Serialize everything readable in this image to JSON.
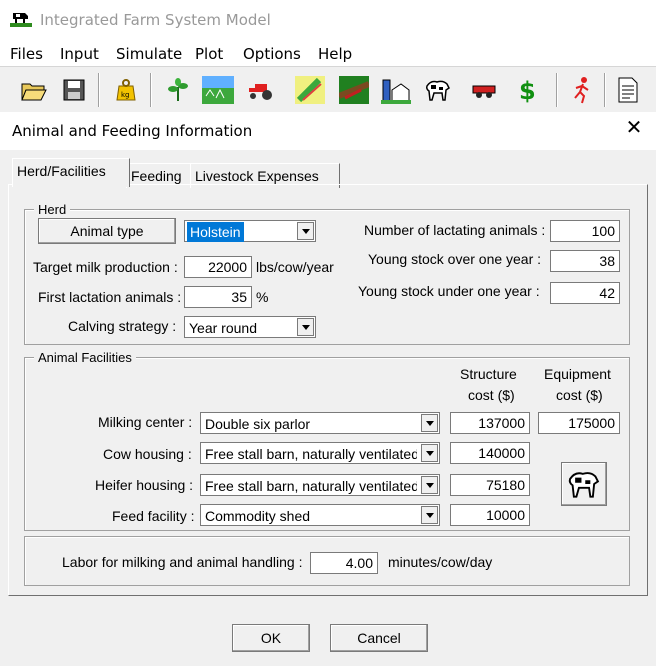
{
  "window": {
    "title": "Integrated Farm System Model"
  },
  "menu": {
    "items": [
      "Files",
      "Input",
      "Simulate",
      "Plot",
      "Options",
      "Help"
    ]
  },
  "toolbar": {
    "icons": [
      "open-folder-icon",
      "save-disk-icon",
      "weight-kg-icon",
      "crop-plant-icon",
      "field-icon",
      "tractor-icon",
      "harvest-icon",
      "tillage-icon",
      "storage-icon",
      "cow-icon",
      "trailer-icon",
      "dollar-icon",
      "runner-icon",
      "report-icon"
    ]
  },
  "dialog": {
    "title": "Animal and Feeding Information",
    "tabs": [
      "Herd/Facilities",
      "Feeding",
      "Livestock Expenses"
    ],
    "herd": {
      "legend": "Herd",
      "animal_type_button": "Animal type",
      "animal_type_value": "Holstein",
      "target_milk_label": "Target milk production :",
      "target_milk_value": "22000",
      "target_milk_unit": "lbs/cow/year",
      "first_lactation_label": "First lactation animals :",
      "first_lactation_value": "35",
      "first_lactation_unit": "%",
      "calving_label": "Calving strategy :",
      "calving_value": "Year round",
      "lactating_label": "Number of lactating animals :",
      "lactating_value": "100",
      "young_over_label": "Young stock over one year :",
      "young_over_value": "38",
      "young_under_label": "Young stock under one year :",
      "young_under_value": "42"
    },
    "facilities": {
      "legend": "Animal Facilities",
      "structure_header_1": "Structure",
      "structure_header_2": "cost ($)",
      "equipment_header_1": "Equipment",
      "equipment_header_2": "cost ($)",
      "milking_label": "Milking center :",
      "milking_value": "Double six parlor",
      "milking_structure": "137000",
      "milking_equipment": "175000",
      "cow_housing_label": "Cow housing :",
      "cow_housing_value": "Free stall barn, naturally ventilated",
      "cow_housing_structure": "140000",
      "heifer_label": "Heifer housing :",
      "heifer_value": "Free stall barn, naturally ventilated",
      "heifer_structure": "75180",
      "feed_label": "Feed facility :",
      "feed_value": "Commodity shed",
      "feed_structure": "10000"
    },
    "labor": {
      "label": "Labor for milking and animal handling :",
      "value": "4.00",
      "unit": "minutes/cow/day"
    },
    "ok_label": "OK",
    "cancel_label": "Cancel"
  }
}
